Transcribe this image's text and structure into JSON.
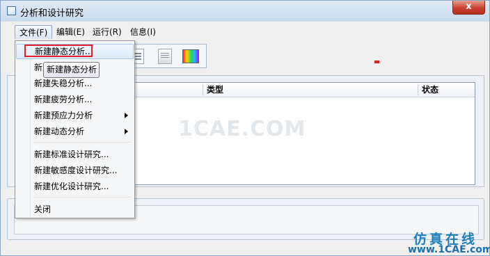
{
  "window": {
    "title": "分析和设计研究",
    "close_label": "x"
  },
  "menubar": {
    "items": [
      {
        "label": "文件(F)"
      },
      {
        "label": "编辑(E)"
      },
      {
        "label": "运行(R)"
      },
      {
        "label": "信息(I)"
      }
    ]
  },
  "toolbar": {
    "icons": [
      "list-icon",
      "document-icon",
      "color-result-icon"
    ]
  },
  "table": {
    "columns": [
      "类型",
      "状态"
    ]
  },
  "file_menu": {
    "items": [
      {
        "label": "新建静态分析...",
        "highlighted": true
      },
      {
        "label": "新建模态分析..."
      },
      {
        "label": "新建失稳分析..."
      },
      {
        "label": "新建疲劳分析..."
      },
      {
        "label": "新建预应力分析",
        "submenu": true
      },
      {
        "label": "新建动态分析",
        "submenu": true
      },
      {
        "label": "新建标准设计研究..."
      },
      {
        "label": "新建敏感度设计研究..."
      },
      {
        "label": "新建优化设计研究..."
      },
      {
        "label": "关闭"
      }
    ]
  },
  "tooltip": {
    "text": "新建静态分析"
  },
  "watermark": {
    "text": "1CAE.COM"
  },
  "branding": {
    "cn": "仿真在线",
    "url": "www.1CAE.com"
  },
  "colors": {
    "accent": "#1f7fbe",
    "highlight_box": "#e0202a",
    "close_button": "#c8412e"
  }
}
